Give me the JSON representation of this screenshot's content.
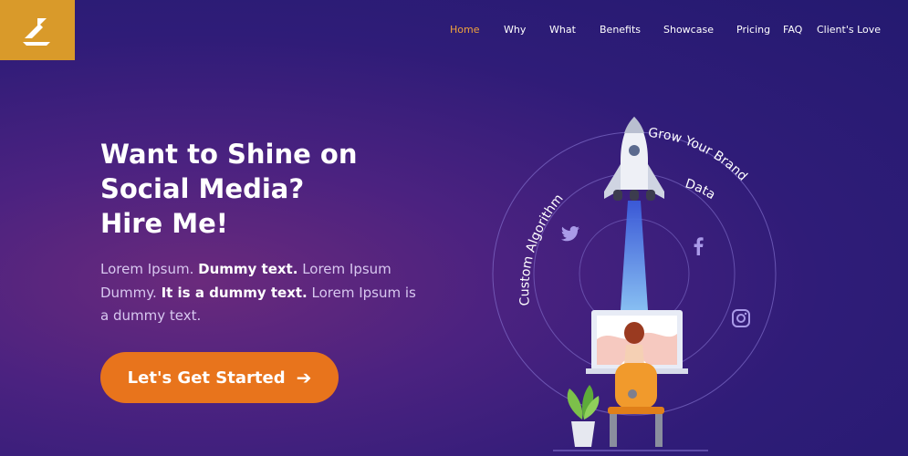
{
  "nav": {
    "items": [
      {
        "label": "Home",
        "active": true
      },
      {
        "label": "Why"
      },
      {
        "label": "What"
      },
      {
        "label": "Benefits"
      },
      {
        "label": "Showcase"
      },
      {
        "label": "Pricing"
      },
      {
        "label": "FAQ"
      },
      {
        "label": "Client's Love"
      }
    ]
  },
  "hero": {
    "title_lines": [
      "Want to Shine on",
      "Social Media?",
      "Hire Me!"
    ],
    "desc": {
      "p1": "Lorem Ipsum. ",
      "b1": "Dummy text.",
      "p2": " Lorem Ipsum Dummy. ",
      "b2": "It is a dummy text.",
      "p3": " Lorem Ipsum is a dummy text."
    },
    "cta_label": "Let's Get Started",
    "cta_icon": "arrow-right-icon"
  },
  "illustration": {
    "arc_labels": {
      "grow": "Grow Your Brand",
      "data": "Data",
      "algo": "Custom Algorithm"
    },
    "icons": [
      "twitter-icon",
      "facebook-icon",
      "instagram-icon",
      "rocket-icon"
    ]
  },
  "colors": {
    "logo_bg": "#d99a2a",
    "nav_active": "#f0a23c",
    "cta": "#e8741c"
  }
}
